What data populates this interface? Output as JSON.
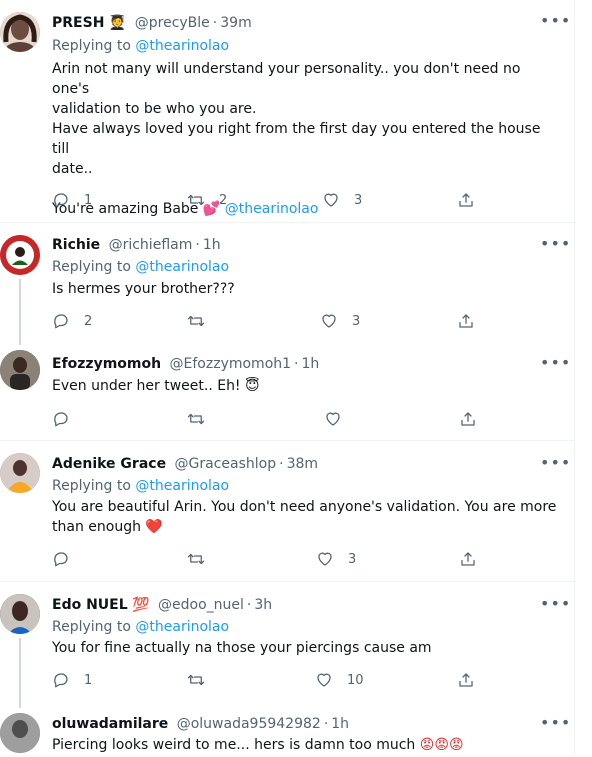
{
  "tweets": [
    {
      "name": "PRESH",
      "badge": "🧑‍🎓",
      "handle": "@precyBle",
      "time": "39m",
      "reply_prefix": "Replying to",
      "reply_to": "@thearinolao",
      "lines": [
        "Arin not many will understand your personality.. you don't need no one's",
        "validation to be who you are.",
        "Have always loved you right from the first day you entered the house till",
        "date..",
        "",
        "You're amazing Babe"
      ],
      "trail_emoji": "💕",
      "trail_mention": "@thearinolao",
      "replies": "1",
      "retweets": "2",
      "likes": "3",
      "avatar_color": "#8d6e63"
    },
    {
      "name": "Richie",
      "handle": "@richieflam",
      "time": "1h",
      "reply_prefix": "Replying to",
      "reply_to": "@thearinolao",
      "lines": [
        "Is hermes your brother???"
      ],
      "replies": "2",
      "retweets": "",
      "likes": "3",
      "avatar_color": "#d32f2f"
    },
    {
      "name": "Efozzymomoh",
      "handle": "@Efozzymomoh1",
      "time": "1h",
      "lines": [
        "Even under her tweet.. Eh!"
      ],
      "trail_emoji": "😇",
      "replies": "",
      "retweets": "",
      "likes": "",
      "avatar_color": "#5d5448"
    },
    {
      "name": "Adenike Grace",
      "handle": "@Graceashlop",
      "time": "38m",
      "reply_prefix": "Replying to",
      "reply_to": "@thearinolao",
      "lines": [
        "You are beautiful Arin. You don't need anyone's validation. You are more",
        "than enough"
      ],
      "trail_emoji": "❤️",
      "replies": "",
      "retweets": "",
      "likes": "3",
      "avatar_color": "#a1887f"
    },
    {
      "name": "Edo NUEL",
      "badge": "💯",
      "handle": "@edoo_nuel",
      "time": "3h",
      "reply_prefix": "Replying to",
      "reply_to": "@thearinolao",
      "lines": [
        "You for fine actually na those your piercings cause am"
      ],
      "replies": "1",
      "retweets": "",
      "likes": "10",
      "avatar_color": "#3e2f2a"
    },
    {
      "name": "oluwadamilare",
      "handle": "@oluwada95942982",
      "time": "1h",
      "lines": [
        "Piercing looks weird to me... hers is damn too much"
      ],
      "trail_emoji": "😡😡😡",
      "avatar_color": "#6d6d6d"
    }
  ],
  "icons": {
    "reply": "reply-icon",
    "retweet": "retweet-icon",
    "like": "like-icon",
    "share": "share-icon",
    "more": "more-icon"
  },
  "colors": {
    "link": "#1d9bf0",
    "secondary": "#536471",
    "divider": "#eff3f4"
  }
}
